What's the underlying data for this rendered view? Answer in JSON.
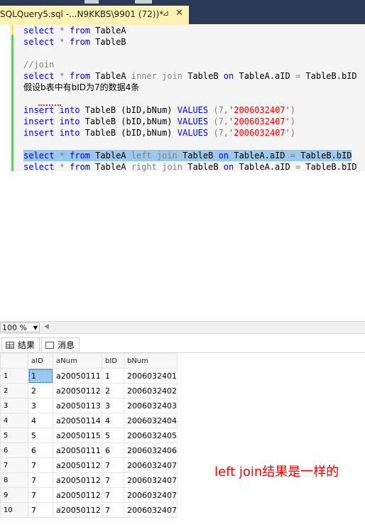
{
  "tab": {
    "title": "SQLQuery5.sql -...N9KKBS\\9901 (72))*",
    "pin_glyph": "⊿",
    "close_glyph": "✕"
  },
  "editor": {
    "line1": [
      "select",
      " * ",
      "from",
      " TableA"
    ],
    "line2": [
      "select",
      " * ",
      "from",
      " TableB"
    ],
    "comment": "//join",
    "line4": [
      "select",
      " * ",
      "from",
      " TableA ",
      "inner join",
      " TableB ",
      "on",
      " TableA.aID ",
      "=",
      " TableB.bID"
    ],
    "cjk_line": "假设b表中有bID为7的数据4条",
    "insert_line": [
      "insert",
      " into",
      " TableB ",
      "(bID,bNum)",
      " ",
      "VALUES",
      " ",
      "(7,",
      "'2006032407'",
      ")"
    ],
    "left_join_line": [
      "select",
      " * ",
      "from",
      " TableA ",
      "left join",
      " TableB ",
      "on",
      " TableA.aID ",
      "=",
      " TableB.bID"
    ],
    "right_join_line": [
      "select",
      " * ",
      "from",
      " TableA ",
      "right join",
      " TableB ",
      "on",
      " TableA.aID ",
      "=",
      " TableB.bID"
    ]
  },
  "zoom": "100 %",
  "result_tabs": {
    "results": "结果",
    "messages": "消息"
  },
  "grid": {
    "columns": [
      "",
      "aID",
      "aNum",
      "bID",
      "bNum"
    ],
    "rows": [
      [
        "1",
        "1",
        "a20050111",
        "1",
        "2006032401"
      ],
      [
        "2",
        "2",
        "a20050112",
        "2",
        "2006032402"
      ],
      [
        "3",
        "3",
        "a20050113",
        "3",
        "2006032403"
      ],
      [
        "4",
        "4",
        "a20050114",
        "4",
        "2006032404"
      ],
      [
        "5",
        "5",
        "a20050115",
        "5",
        "2006032405"
      ],
      [
        "6",
        "6",
        "a20050111",
        "6",
        "2006032406"
      ],
      [
        "7",
        "7",
        "a20050112",
        "7",
        "2006032407"
      ],
      [
        "8",
        "7",
        "a20050112",
        "7",
        "2006032407"
      ],
      [
        "9",
        "7",
        "a20050112",
        "7",
        "2006032407"
      ],
      [
        "10",
        "7",
        "a20050112",
        "7",
        "2006032407"
      ]
    ]
  },
  "annotation": "left join结果是一样的"
}
